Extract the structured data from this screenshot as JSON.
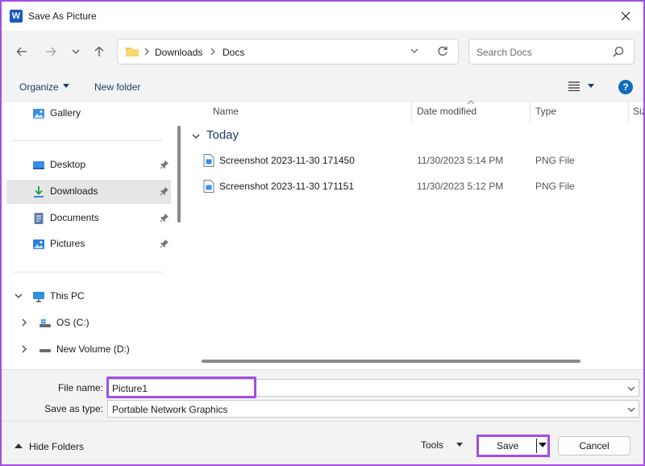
{
  "window": {
    "title": "Save As Picture",
    "app_icon_letter": "W"
  },
  "address": {
    "breadcrumb": [
      "Downloads",
      "Docs"
    ],
    "search_placeholder": "Search Docs"
  },
  "commandbar": {
    "organize": "Organize",
    "new_folder": "New folder"
  },
  "sidebar": {
    "gallery": "Gallery",
    "desktop": "Desktop",
    "downloads": "Downloads",
    "documents": "Documents",
    "pictures": "Pictures",
    "this_pc": "This PC",
    "os_c": "OS (C:)",
    "new_volume": "New Volume (D:)",
    "selected": "Downloads"
  },
  "filelist": {
    "columns": {
      "name": "Name",
      "date_modified": "Date modified",
      "type": "Type",
      "size": "Size"
    },
    "group": "Today",
    "rows": [
      {
        "name": "Screenshot 2023-11-30 171450",
        "date": "11/30/2023 5:14 PM",
        "type": "PNG File"
      },
      {
        "name": "Screenshot 2023-11-30 171151",
        "date": "11/30/2023 5:12 PM",
        "type": "PNG File"
      }
    ]
  },
  "fields": {
    "file_name_label": "File name:",
    "file_name_value": "Picture1",
    "save_type_label": "Save as type:",
    "save_type_value": "Portable Network Graphics"
  },
  "footer": {
    "hide_folders": "Hide Folders",
    "tools": "Tools",
    "save": "Save",
    "cancel": "Cancel"
  },
  "colors": {
    "highlight": "#a24ee0",
    "accent": "#0f6cbd"
  }
}
